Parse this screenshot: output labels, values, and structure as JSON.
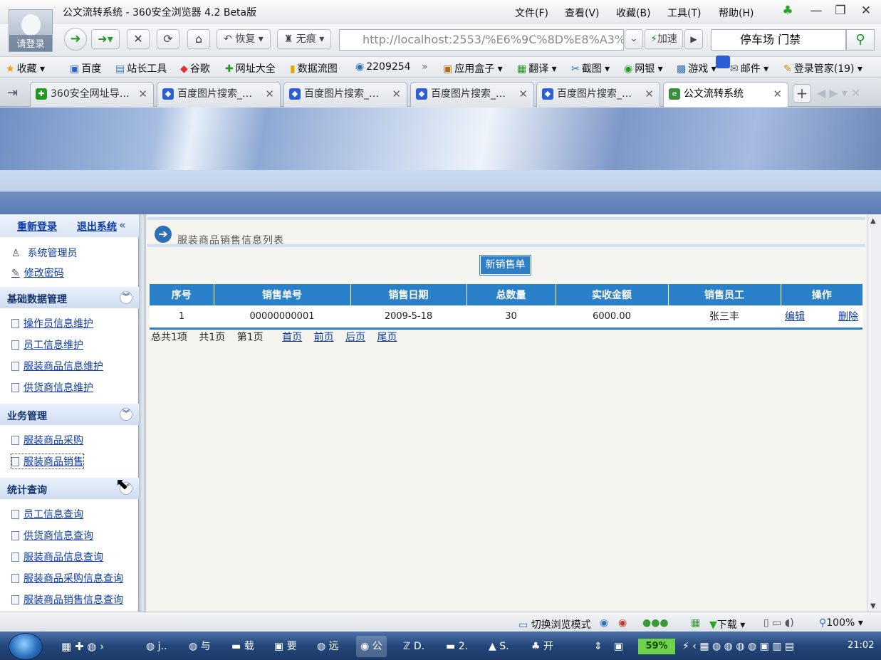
{
  "browser": {
    "title": "公文流转系统 - 360安全浏览器 4.2 Beta版",
    "login_label": "请登录",
    "menu": [
      "文件(F)",
      "查看(V)",
      "收藏(B)",
      "工具(T)",
      "帮助(H)"
    ],
    "restore_label": "恢复",
    "incognito_label": "无痕",
    "address": "http://localhost:2553/%E6%9C%8D%E8%A3%",
    "accelerate_label": "加速",
    "search_value": "停车场 门禁"
  },
  "favorites": {
    "items": [
      "收藏",
      "百度",
      "站长工具",
      "谷歌",
      "网址大全",
      "数据流图",
      "2209254"
    ],
    "right_items": [
      "应用盒子",
      "翻译",
      "截图",
      "网银",
      "游戏",
      "邮件",
      "登录管家(19)"
    ]
  },
  "tabs": [
    {
      "label": "360安全网址导…"
    },
    {
      "label": "百度图片搜索_…"
    },
    {
      "label": "百度图片搜索_…"
    },
    {
      "label": "百度图片搜索_…"
    },
    {
      "label": "百度图片搜索_…"
    },
    {
      "label": "公文流转系统"
    }
  ],
  "sidebar": {
    "relogin": "重新登录",
    "logout": "退出系统",
    "user": "系统管理员",
    "change_password": "修改密码",
    "sections": [
      {
        "title": "基础数据管理",
        "items": [
          "操作员信息维护",
          "员工信息维护",
          "服装商品信息维护",
          "供货商信息维护"
        ]
      },
      {
        "title": "业务管理",
        "items": [
          "服装商品采购",
          "服装商品销售"
        ]
      },
      {
        "title": "统计查询",
        "items": [
          "员工信息查询",
          "供货商信息查询",
          "服装商品信息查询",
          "服装商品采购信息查询",
          "服装商品销售信息查询"
        ]
      }
    ]
  },
  "main": {
    "caption": "服装商品销售信息列表",
    "new_button": "新销售单",
    "columns": [
      "序号",
      "销售单号",
      "销售日期",
      "总数量",
      "实收金额",
      "销售员工",
      "操作"
    ],
    "rows": [
      {
        "index": "1",
        "order_no": "00000000001",
        "date": "2009-5-18",
        "quantity": "30",
        "amount": "6000.00",
        "staff": "张三丰",
        "edit": "编辑",
        "delete": "删除"
      }
    ],
    "pager": {
      "total": "总共1项",
      "pages": "共1页",
      "current": "第1页",
      "first": "首页",
      "prev": "前页",
      "next": "后页",
      "last": "尾页"
    }
  },
  "statusbar": {
    "mode": "切换浏览模式",
    "download": "下载",
    "zoom": "100%"
  },
  "taskbar": {
    "tasks": [
      "j..",
      "与",
      "载",
      "要",
      "远",
      "公",
      "D.",
      "2.",
      "S.",
      "开"
    ],
    "battery": "59%",
    "time": "21:02"
  }
}
